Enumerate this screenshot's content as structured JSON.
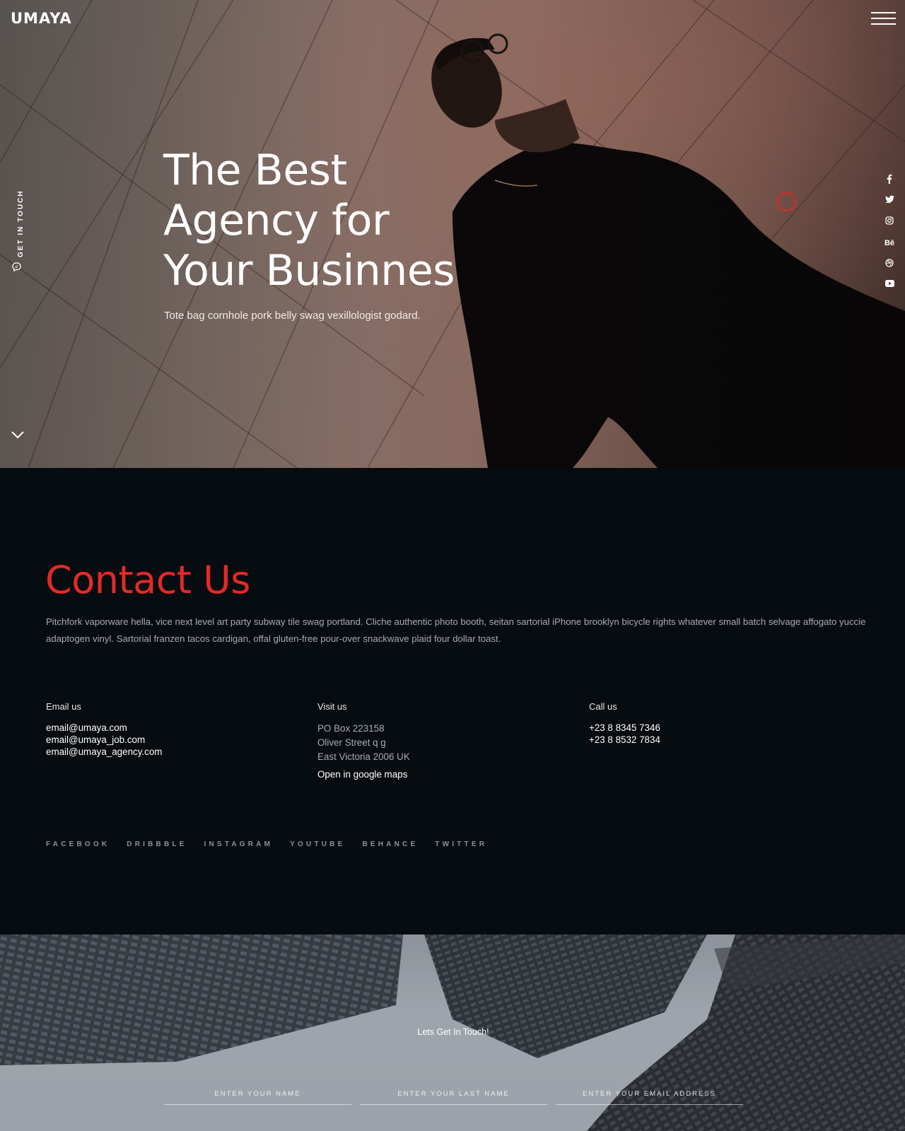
{
  "header": {
    "logo_text": "UMAYA"
  },
  "hero": {
    "get_in_touch": "GET IN TOUCH",
    "headline_lines": [
      "The Best",
      "Agency for",
      "Your Businnes"
    ],
    "subline": "Tote bag cornhole pork belly swag vexillologist godard.",
    "social_icons": [
      "facebook-icon",
      "twitter-icon",
      "instagram-icon",
      "behance-icon",
      "dribbble-icon",
      "youtube-icon"
    ],
    "behance_glyph": "Bē"
  },
  "contact": {
    "title": "Contact Us",
    "description": "Pitchfork vaporware hella, vice next level art party subway tile swag portland. Cliche authentic photo booth, seitan sartorial iPhone brooklyn bicycle rights whatever small batch selvage affogato yuccie adaptogen vinyl. Sartorial franzen tacos cardigan, offal gluten-free pour-over snackwave plaid four dollar toast.",
    "email": {
      "label": "Email us",
      "lines": [
        "email@umaya.com",
        "email@umaya_job.com",
        "email@umaya_agency.com"
      ]
    },
    "visit": {
      "label": "Visit us",
      "lines": [
        "PO Box 223158",
        "Oliver Street q g",
        "East Victoria 2006 UK"
      ],
      "maps_link": "Open in google maps"
    },
    "call": {
      "label": "Call us",
      "lines": [
        "+23 8 8345 7346",
        "+23 8 8532 7834"
      ]
    },
    "social_links": [
      "FACEBOOK",
      "DRIBBBLE",
      "INSTAGRAM",
      "YOUTUBE",
      "BEHANCE",
      "TWITTER"
    ]
  },
  "touch": {
    "title": "Lets Get In Touch!",
    "fields": [
      {
        "placeholder": "ENTER YOUR NAME"
      },
      {
        "placeholder": "ENTER YOUR LAST NAME"
      },
      {
        "placeholder": "ENTER YOUR EMAIL ADDRESS"
      }
    ]
  },
  "colors": {
    "accent": "#e22a27",
    "dark_bg": "#070c10",
    "muted_text": "#a8acb0"
  }
}
